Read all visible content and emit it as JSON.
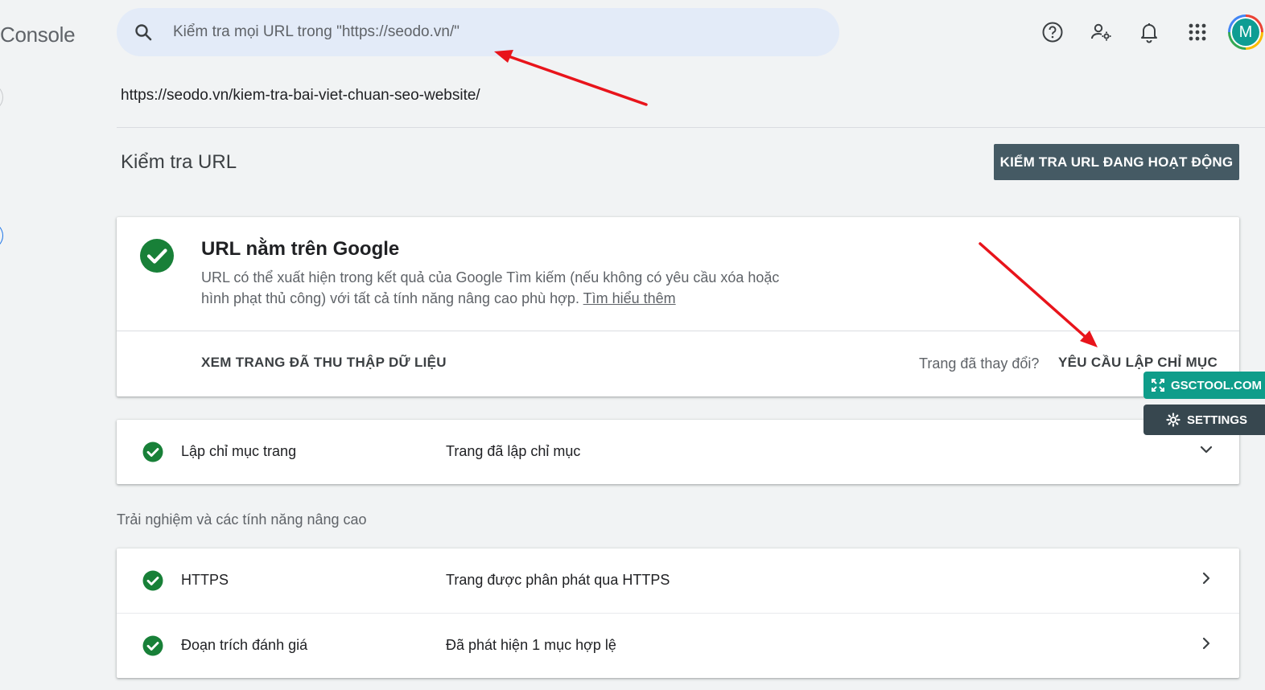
{
  "header": {
    "app_title": "Console",
    "search_placeholder": "Kiểm tra mọi URL trong \"https://seodo.vn/\"",
    "avatar_letter": "M"
  },
  "inspected_url": "https://seodo.vn/kiem-tra-bai-viet-chuan-seo-website/",
  "section": {
    "title": "Kiểm tra URL",
    "live_test_label": "KIỂM TRA URL ĐANG HOẠT ĐỘNG"
  },
  "status": {
    "title": "URL nằm trên Google",
    "description": "URL có thể xuất hiện trong kết quả của Google Tìm kiếm (nếu không có yêu cầu xóa hoặc hình phạt thủ công) với tất cả tính năng nâng cao phù hợp.",
    "learn_more": "Tìm hiểu thêm",
    "view_crawled": "XEM TRANG ĐÃ THU THẬP DỮ LIỆU",
    "changed_question": "Trang đã thay đổi?",
    "request_indexing": "YÊU CẦU LẬP CHỈ MỤC"
  },
  "indexing": {
    "label": "Lập chỉ mục trang",
    "value": "Trang đã lập chỉ mục"
  },
  "enhancements": {
    "heading": "Trải nghiệm và các tính năng nâng cao",
    "items": [
      {
        "label": "HTTPS",
        "value": "Trang được phân phát qua HTTPS"
      },
      {
        "label": "Đoạn trích đánh giá",
        "value": "Đã phát hiện 1 mục hợp lệ"
      }
    ]
  },
  "overlay": {
    "gsctool_label": "GSCTOOL.COM",
    "settings_label": "SETTINGS"
  },
  "colors": {
    "success_green": "#188038",
    "annotation_red": "#e8141b",
    "gsctool_teal": "#0f9d8a",
    "settings_dark": "#37474f",
    "live_test_bg": "#455a64"
  }
}
